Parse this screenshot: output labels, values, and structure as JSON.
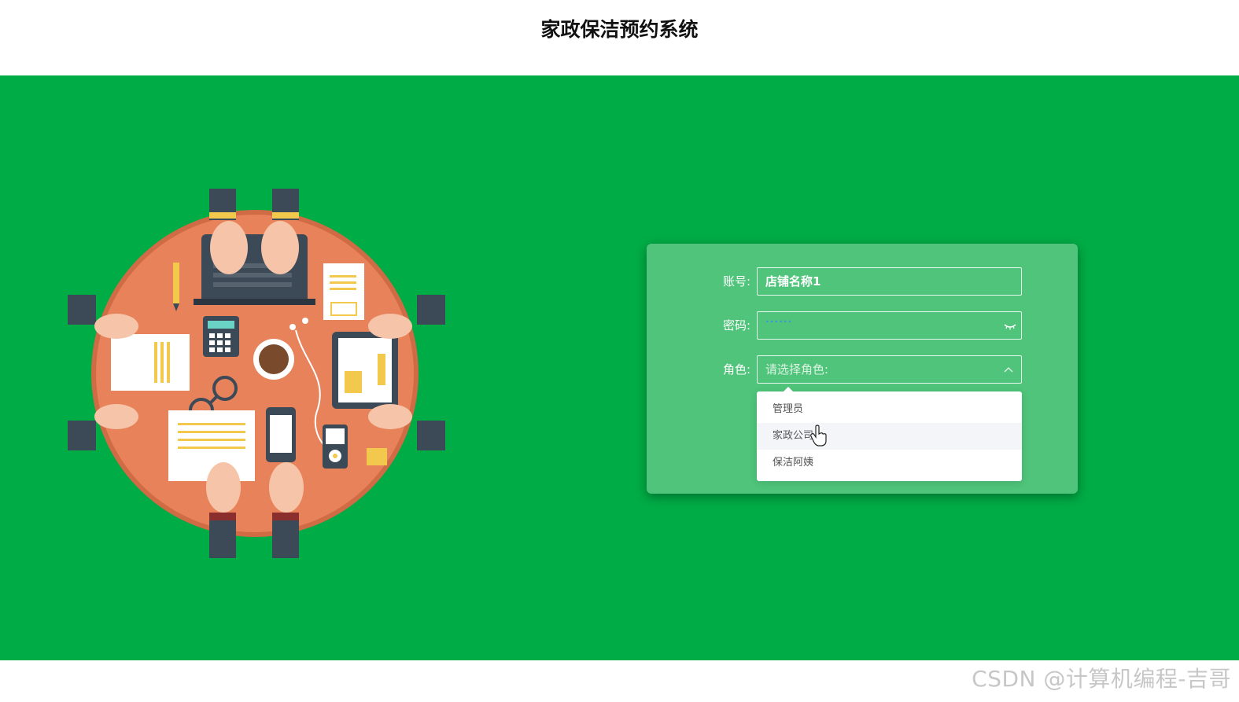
{
  "header": {
    "title": "家政保洁预约系统"
  },
  "login": {
    "account_label": "账号:",
    "account_value": "店铺名称1",
    "password_label": "密码:",
    "password_value": "••••••",
    "role_label": "角色:",
    "role_placeholder": "请选择角色:"
  },
  "role_dropdown": {
    "items": [
      {
        "label": "管理员"
      },
      {
        "label": "家政公司"
      },
      {
        "label": "保洁阿姨"
      }
    ]
  },
  "colors": {
    "background": "#00ac45",
    "card": "#4fc47a",
    "table": "#e8825a",
    "sleeve": "#3c4a57"
  },
  "watermark": "CSDN @计算机编程-吉哥"
}
